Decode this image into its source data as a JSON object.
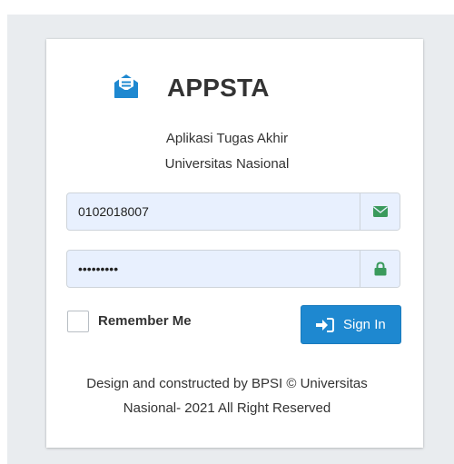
{
  "app": {
    "title": "APPSTA",
    "subtitle_line1": "Aplikasi Tugas Akhir",
    "subtitle_line2": "Universitas Nasional"
  },
  "form": {
    "username_value": "0102018007",
    "username_icon": "envelope-icon",
    "password_value": "•••••••••",
    "password_icon": "lock-icon",
    "remember_label": "Remember Me",
    "remember_checked": false,
    "signin_label": "Sign In",
    "signin_icon": "sign-in-icon"
  },
  "footer": {
    "line1": "Design and constructed by BPSI © Universitas",
    "line2": "Nasional- 2021 All Right Reserved"
  },
  "colors": {
    "accent": "#1e88d0",
    "icon_green": "#3a9a5c",
    "input_bg": "#e8f0fe",
    "page_bg": "#e9ecef"
  }
}
